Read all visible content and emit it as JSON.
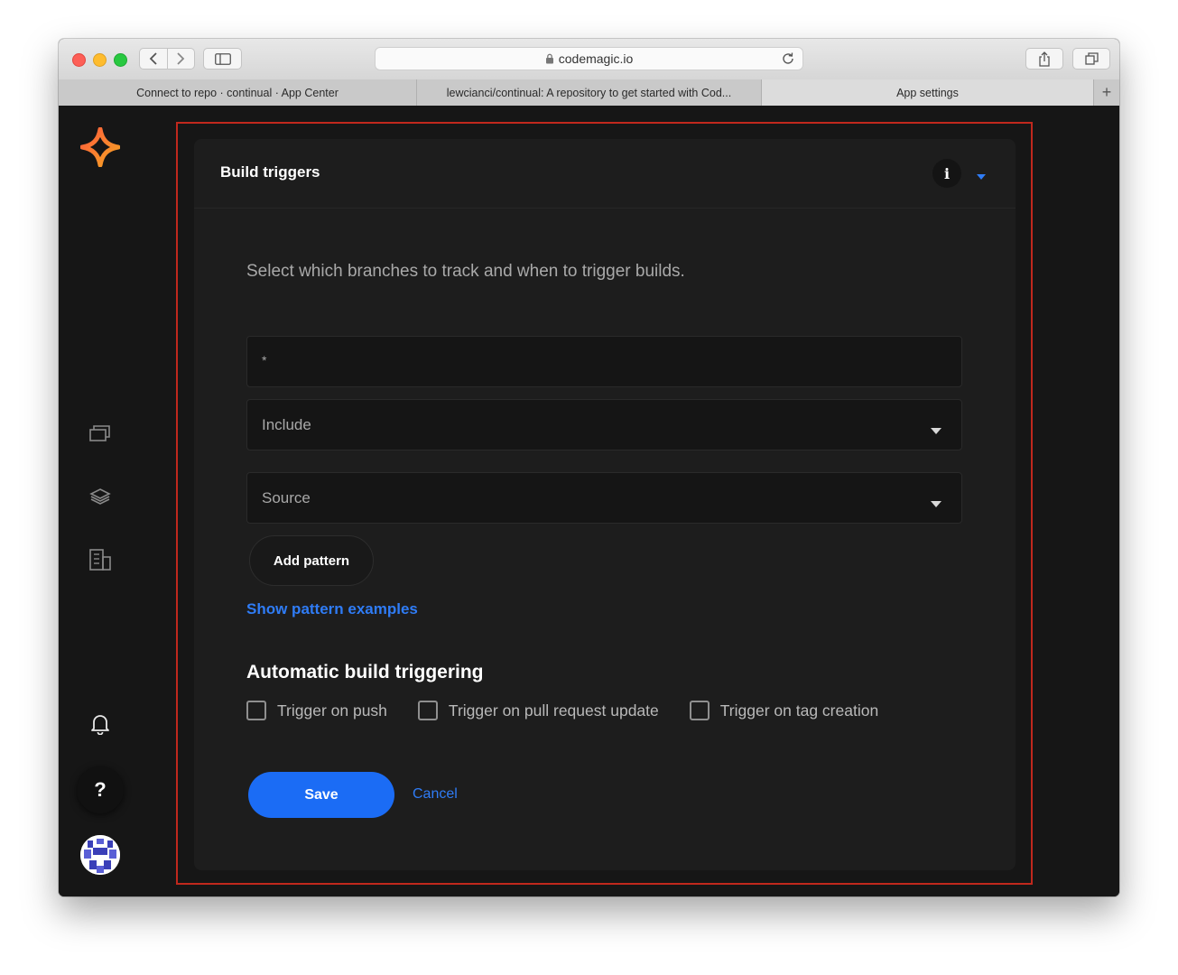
{
  "browser": {
    "address": "codemagic.io",
    "tabs": [
      {
        "label": "Connect to repo · continual · App Center"
      },
      {
        "label": "lewcianci/continual: A repository to get started with Cod..."
      },
      {
        "label": "App settings"
      }
    ],
    "new_tab_label": "+"
  },
  "sidebar": {
    "icons": [
      "codemagic-logo-icon",
      "apps-icon",
      "layers-icon",
      "teams-icon",
      "bell-icon",
      "help-icon",
      "avatar"
    ],
    "help_label": "?"
  },
  "card": {
    "title": "Build triggers",
    "info_label": "i",
    "description": "Select which branches to track and when to trigger builds.",
    "pattern_value": "*",
    "include_select": "Include",
    "source_select": "Source",
    "add_pattern_label": "Add pattern",
    "examples_link": "Show pattern examples",
    "auto_title": "Automatic build triggering",
    "checkboxes": [
      {
        "label": "Trigger on push",
        "checked": false
      },
      {
        "label": "Trigger on pull request update",
        "checked": false
      },
      {
        "label": "Trigger on tag creation",
        "checked": false
      }
    ],
    "save_label": "Save",
    "cancel_label": "Cancel"
  },
  "colors": {
    "accent": "#1b6cf5",
    "link": "#2f7cf6",
    "highlight_border": "#c0281d",
    "background": "#161616",
    "card": "#1d1d1d"
  }
}
